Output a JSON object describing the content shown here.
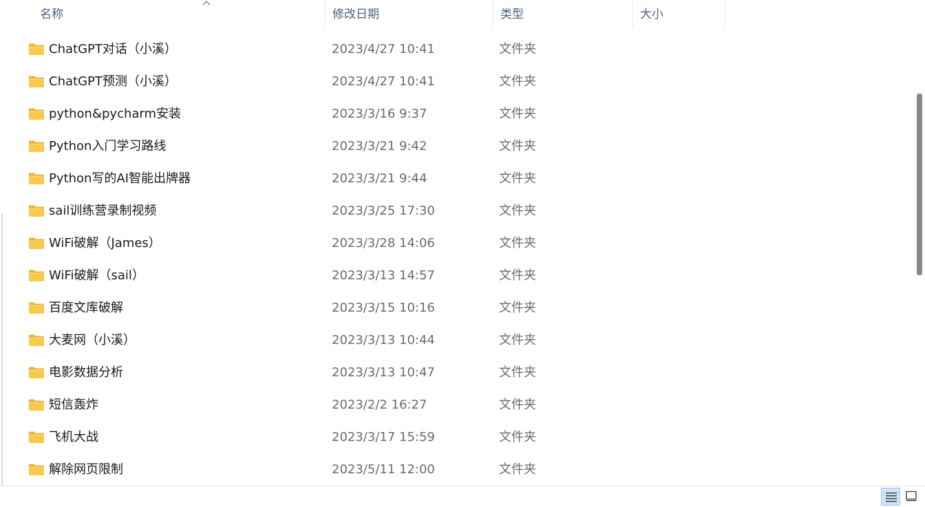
{
  "columns": {
    "name": "名称",
    "date": "修改日期",
    "type": "类型",
    "size": "大小"
  },
  "files": [
    {
      "name": "ChatGPT对话（小溪）",
      "date": "2023/4/27 10:41",
      "type": "文件夹"
    },
    {
      "name": "ChatGPT预测（小溪）",
      "date": "2023/4/27 10:41",
      "type": "文件夹"
    },
    {
      "name": "python&pycharm安装",
      "date": "2023/3/16 9:37",
      "type": "文件夹"
    },
    {
      "name": "Python入门学习路线",
      "date": "2023/3/21 9:42",
      "type": "文件夹"
    },
    {
      "name": "Python写的AI智能出牌器",
      "date": "2023/3/21 9:44",
      "type": "文件夹"
    },
    {
      "name": "sail训练营录制视频",
      "date": "2023/3/25 17:30",
      "type": "文件夹"
    },
    {
      "name": "WiFi破解（James）",
      "date": "2023/3/28 14:06",
      "type": "文件夹"
    },
    {
      "name": "WiFi破解（sail）",
      "date": "2023/3/13 14:57",
      "type": "文件夹"
    },
    {
      "name": "百度文库破解",
      "date": "2023/3/15 10:16",
      "type": "文件夹"
    },
    {
      "name": "大麦网（小溪）",
      "date": "2023/3/13 10:44",
      "type": "文件夹"
    },
    {
      "name": "电影数据分析",
      "date": "2023/3/13 10:47",
      "type": "文件夹"
    },
    {
      "name": "短信轰炸",
      "date": "2023/2/2 16:27",
      "type": "文件夹"
    },
    {
      "name": "飞机大战",
      "date": "2023/3/17 15:59",
      "type": "文件夹"
    },
    {
      "name": "解除网页限制",
      "date": "2023/5/11 12:00",
      "type": "文件夹"
    }
  ],
  "icons": {
    "folder": "folder-icon",
    "sort": "sort-ascending-icon",
    "details_view": "details-view-icon",
    "tiles_view": "large-icons-view-icon"
  },
  "colors": {
    "header_text": "#4c607a",
    "folder_yellow": "#f8c94a",
    "selected_view_bg": "#cce4f7"
  }
}
